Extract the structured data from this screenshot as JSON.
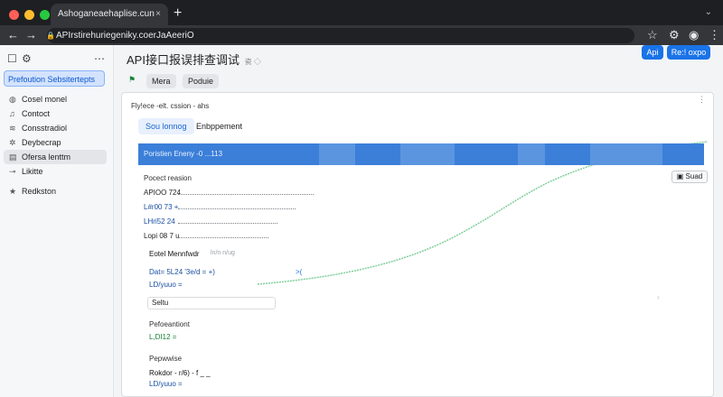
{
  "browser": {
    "tab_title": "Ashoganeaehaplise.cun",
    "url": "APIrstirehuriegeniky.coerJaAeeriO",
    "controls": {
      "close_tab": "×",
      "new_tab": "+",
      "back": "←",
      "forward": "→",
      "reload": "C",
      "extensions": "⚙",
      "menu": "⋮"
    }
  },
  "sidebar": {
    "project_button": "Prefoution Sebsitertepts",
    "items": [
      {
        "label": "Cosel monel",
        "icon": "globe-icon"
      },
      {
        "label": "Contoct",
        "icon": "music-note-icon"
      },
      {
        "label": "Consstradiol",
        "icon": "stack-icon"
      },
      {
        "label": "Deybecrap",
        "icon": "gear-icon"
      },
      {
        "label": "Ofersa lenttm",
        "icon": "document-icon"
      },
      {
        "label": "Likitte",
        "icon": "link-icon"
      },
      {
        "label": "Redkston",
        "icon": "star-icon"
      }
    ]
  },
  "header": {
    "title": "API接口报误排查调试",
    "title_suffix": "瓷 ◇",
    "api_button": "Api",
    "run_button": "Re:! oxpo"
  },
  "toolbar": {
    "mera": "Mera",
    "poduie": "Poduie"
  },
  "panel": {
    "heading": "Fly!ece -elt. cssion - ahs",
    "tabs": [
      "Sou lonnog",
      "Enbppement"
    ],
    "banner": "Poristien Eneny -0 ...113",
    "send_button": "Suad",
    "project_section_title": "Pocect reasion",
    "rows": [
      {
        "key": "APIOO 724"
      },
      {
        "key": "L#r00 73 +"
      },
      {
        "key": "LHri52 24"
      },
      {
        "key": "Lopi 08 7 u"
      }
    ],
    "getting_section_title": "Eotel Mennfwdr",
    "getting_section_sub": "ln/n n/ug",
    "data_line": "Dat= 5L24 '3e/d = +)",
    "data_link": ">(",
    "value_line_1": "LD/yuuo =",
    "status_field": "Seltu",
    "pefomation_title": "Pefoeantiont",
    "pefomation_value": "L,DI12 =",
    "pemwise_title": "Pepwwise",
    "rokdor_line": "Rokdor - r/6) - f  _  _",
    "value_line_2": "LD/yuuo ="
  },
  "colors": {
    "accent": "#1a73e8",
    "banner": "#3b7fd9",
    "curve": "#7fcf9a"
  }
}
